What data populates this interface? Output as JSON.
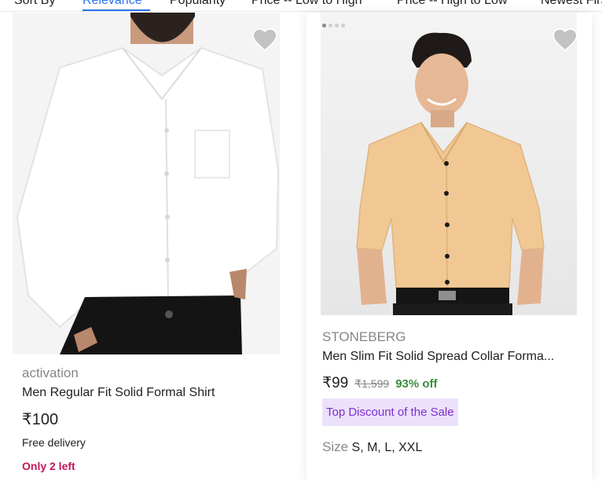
{
  "sort_bar": {
    "label": "Sort By",
    "options": [
      "Relevance",
      "Popularity",
      "Price -- Low to High",
      "Price -- High to Low",
      "Newest First"
    ],
    "active": "Relevance",
    "accent_color": "#2874f0"
  },
  "products": [
    {
      "brand": "activation",
      "title": "Men Regular Fit Solid Formal Shirt",
      "price": "₹100",
      "delivery": "Free delivery",
      "stock": "Only 2 left",
      "wishlist_icon": "heart-icon"
    },
    {
      "brand": "STONEBERG",
      "title": "Men Slim Fit Solid Spread Collar Forma...",
      "price": "₹99",
      "mrp": "₹1,599",
      "discount": "93% off",
      "badge": "Top Discount of the Sale",
      "size_label": "Size",
      "sizes": "S, M, L, XXL",
      "wishlist_icon": "heart-icon"
    }
  ]
}
